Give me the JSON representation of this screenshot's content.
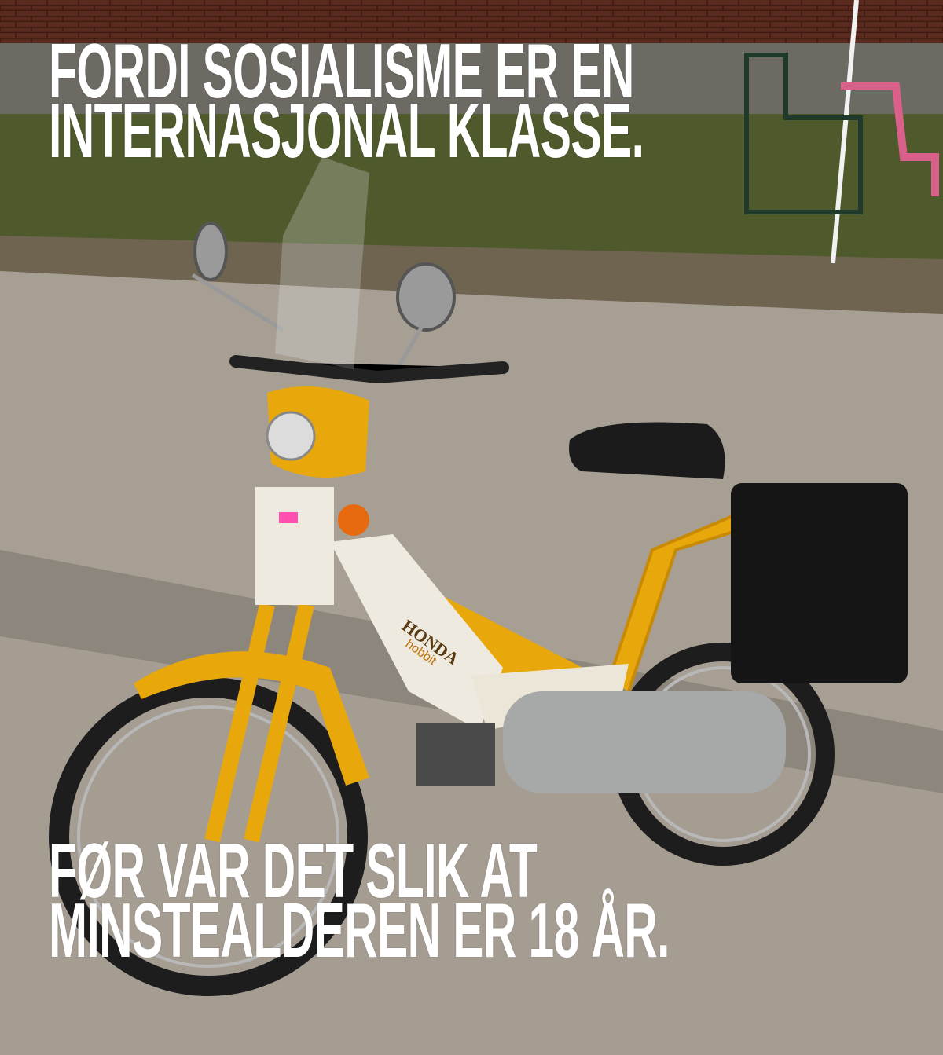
{
  "meme": {
    "top_text": [
      "FORDI SOSIALISME ER EN",
      "INTERNASJONAL KLASSE."
    ],
    "bottom_text": [
      "FØR VAR DET SLIK AT",
      "MINSTEALDEREN ER 18 ÅR."
    ]
  },
  "photo": {
    "brand_logo": "HONDA",
    "model_logo": "hobbit",
    "colors": {
      "moped_yellow": "#e8a80c",
      "pavement": "#a89f94",
      "grass": "#4e5a2c",
      "brick": "#5a2a1e"
    }
  }
}
